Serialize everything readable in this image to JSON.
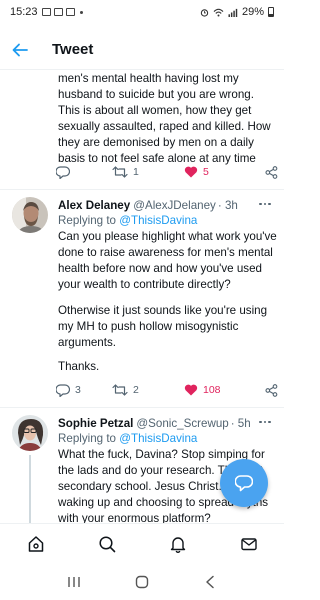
{
  "status_bar": {
    "time": "15:23",
    "battery": "29%"
  },
  "header": {
    "title": "Tweet"
  },
  "tweets": [
    {
      "text": "men's mental health having lost my husband to suicide but you are wrong. This is about all women, how they get sexually assaulted, raped and killed. How they are demonised by men on a daily basis to not feel safe alone at any time",
      "retweets": "1",
      "likes": "5"
    },
    {
      "name": "Alex Delaney",
      "handle": "@AlexJDelaney",
      "time": "· 3h",
      "replying_to_label": "Replying to",
      "replying_to": "@ThisisDavina",
      "paragraphs": [
        "Can you please highlight what work you've done to raise awareness for men's mental health before now and how you've used your wealth to contribute directly?",
        "Otherwise it just sounds like you're using my MH to push hollow misogynistic arguments.",
        "Thanks."
      ],
      "replies": "3",
      "retweets": "2",
      "likes": "108"
    },
    {
      "name": "Sophie Petzal",
      "handle": "@Sonic_Screwup",
      "time": "· 5h",
      "replying_to_label": "Replying to",
      "replying_to": "@ThisisDavina",
      "text": "What the fuck, Davina? Stop simping for the lads and do your research. This isn't secondary school. Jesus Christ. Imagine waking up and choosing to spread myths with your enormous platform?"
    }
  ],
  "colors": {
    "accent": "#1d9bf0",
    "like": "#e0245e",
    "fab": "#4aa3f0",
    "secondary_text": "#536471"
  },
  "icons": {
    "back": "arrow-left-icon",
    "reply": "speech-bubble-icon",
    "retweet": "retweet-icon",
    "like": "heart-icon",
    "share": "share-icon",
    "more": "more-dots-icon",
    "fab": "compose-reply-icon",
    "nav": [
      "home-icon",
      "search-icon",
      "bell-icon",
      "mail-icon"
    ],
    "system": [
      "recent-apps-icon",
      "home-circle-icon",
      "back-chevron-icon"
    ]
  }
}
